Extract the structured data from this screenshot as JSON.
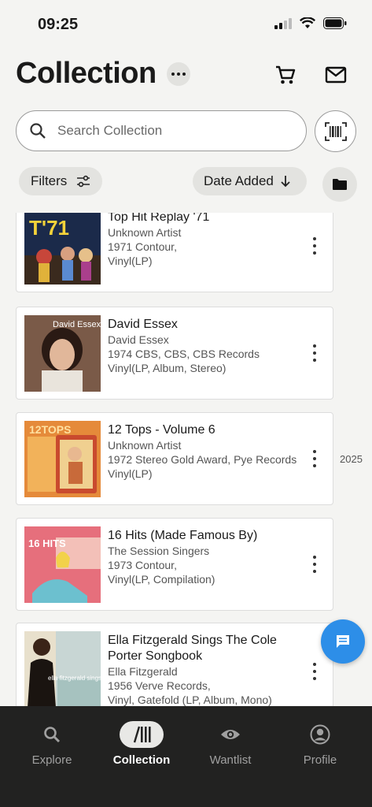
{
  "status": {
    "time": "09:25"
  },
  "header": {
    "title": "Collection",
    "search_placeholder": "Search Collection",
    "filters_label": "Filters",
    "sort_label": "Date Added"
  },
  "year_divider": "2025",
  "records": [
    {
      "title": "Top Hit Replay '71",
      "artist": "Unknown Artist",
      "line1": "1971 Contour,",
      "line2": "Vinyl(LP)"
    },
    {
      "title": "David Essex",
      "artist": "David Essex",
      "line1": "1974 CBS, CBS, CBS Records",
      "line2": "Vinyl(LP, Album, Stereo)"
    },
    {
      "title": "12 Tops - Volume 6",
      "artist": "Unknown Artist",
      "line1": "1972 Stereo Gold Award, Pye Records",
      "line2": "Vinyl(LP)"
    },
    {
      "title": "16 Hits (Made Famous By)",
      "artist": "The Session Singers",
      "line1": "1973 Contour,",
      "line2": "Vinyl(LP, Compilation)"
    },
    {
      "title": "Ella Fitzgerald Sings The Cole Porter Songbook",
      "artist": "Ella Fitzgerald",
      "line1": "1956 Verve Records,",
      "line2": "Vinyl, Gatefold (LP, Album, Mono)"
    }
  ],
  "cover_text": {
    "r1": "T'71",
    "r2": "David Essex",
    "r3": "12TOPS",
    "r4": "16 HITS",
    "r5": "ella fitzgerald sings"
  },
  "tabs": [
    {
      "label": "Explore",
      "icon": "search-icon"
    },
    {
      "label": "Collection",
      "icon": "collection-icon"
    },
    {
      "label": "Wantlist",
      "icon": "eye-icon"
    },
    {
      "label": "Profile",
      "icon": "profile-icon"
    }
  ],
  "colors": {
    "fab": "#2d8ee8",
    "tabbar": "#222221",
    "background": "#f4f4f2"
  }
}
